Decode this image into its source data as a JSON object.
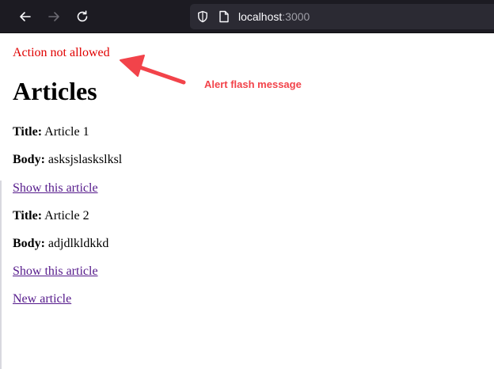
{
  "browser": {
    "url_host": "localhost",
    "url_port": ":3000",
    "icons": {
      "back": "arrow-left-icon",
      "forward": "arrow-right-icon",
      "reload": "reload-icon",
      "security": "shield-icon",
      "page": "page-icon"
    }
  },
  "flash": {
    "alert": "Action not allowed"
  },
  "page": {
    "heading": "Articles",
    "title_label": "Title:",
    "body_label": "Body:",
    "articles": [
      {
        "title": "Article 1",
        "body": "asksjslaskslksl",
        "show_link": "Show this article"
      },
      {
        "title": "Article 2",
        "body": "adjdlkldkkd",
        "show_link": "Show this article"
      }
    ],
    "new_article_link": "New article"
  },
  "annotation": {
    "label": "Alert flash message"
  },
  "colors": {
    "flash_alert": "#e00000",
    "link": "#551a8b",
    "annotation": "#f2434a",
    "toolbar": "#1c1b22",
    "urlbar": "#2b2a33"
  }
}
